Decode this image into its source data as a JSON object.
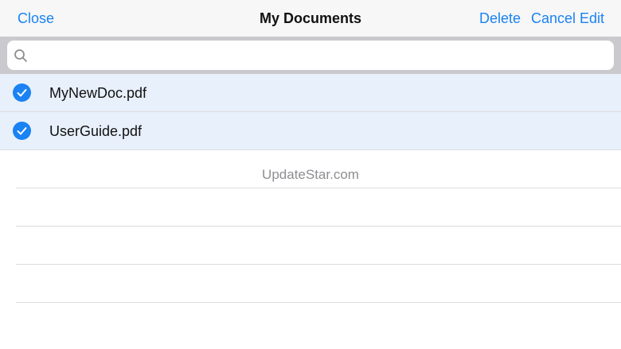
{
  "navbar": {
    "close_label": "Close",
    "title": "My Documents",
    "delete_label": "Delete",
    "cancel_edit_label": "Cancel Edit"
  },
  "search": {
    "placeholder": "",
    "value": ""
  },
  "documents": [
    {
      "name": "MyNewDoc.pdf",
      "selected": true
    },
    {
      "name": "UserGuide.pdf",
      "selected": true
    }
  ],
  "watermark": "UpdateStar.com",
  "colors": {
    "accent": "#1a82f3",
    "selected_row": "#e8f0fb",
    "search_bar_bg": "#c9c9ce",
    "navbar_bg": "#f7f7f8"
  },
  "icons": {
    "search": "search-icon",
    "check": "checkmark-circle-icon"
  }
}
